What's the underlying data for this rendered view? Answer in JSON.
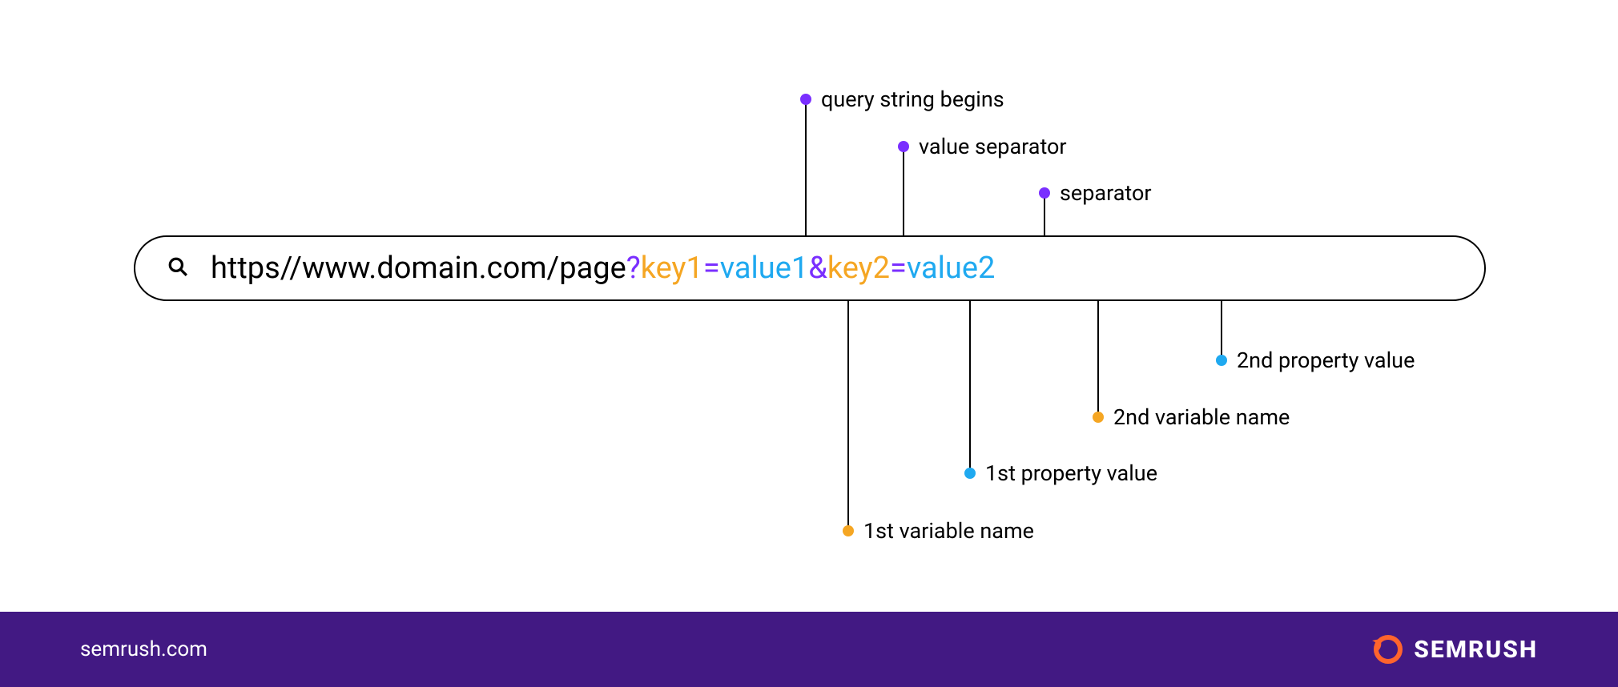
{
  "url": {
    "base": "https//www.domain.com/page",
    "qmark": "?",
    "key1": "key1",
    "eq1": "=",
    "val1": "value1",
    "amp": "&",
    "key2": "key2",
    "eq2": "=",
    "val2": "value2"
  },
  "annotations": {
    "top": {
      "query_begins": "query string begins",
      "value_sep": "value separator",
      "separator": "separator"
    },
    "bottom": {
      "var1": "1st variable name",
      "pval1": "1st property value",
      "var2": "2nd variable name",
      "pval2": "2nd property value"
    }
  },
  "footer": {
    "site": "semrush.com",
    "brand": "SEMRUSH"
  },
  "colors": {
    "purple": "#7a2fff",
    "orange": "#f5a623",
    "blue": "#1fa9f0",
    "footer_bg": "#421983"
  }
}
